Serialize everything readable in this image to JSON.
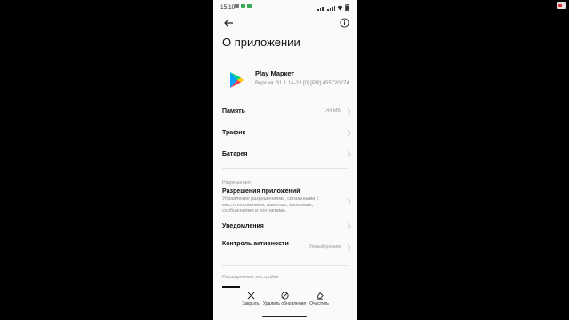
{
  "status_bar": {
    "time": "15:10",
    "right_icons": [
      "signal-icon",
      "signal-icon",
      "wifi-icon",
      "battery-icon"
    ]
  },
  "header": {
    "title": "О приложении"
  },
  "app": {
    "name": "Play Маркет",
    "version": "Версия: 31.1.14-21 [0] [PR] 455720274"
  },
  "rows": {
    "memory": {
      "label": "Память",
      "value": "144 МБ"
    },
    "traffic": {
      "label": "Трафик"
    },
    "battery": {
      "label": "Батарея"
    }
  },
  "permissions": {
    "section": "Разрешения",
    "title": "Разрешения приложений",
    "description": "Управление разрешениями, связанными с местоположением, памятью, вызовами, сообщениями и контактами."
  },
  "notifications": {
    "label": "Уведомления"
  },
  "activity": {
    "label": "Контроль активности",
    "value": "Умный режим"
  },
  "advanced": {
    "section": "Расширенные настройки"
  },
  "bottom_actions": {
    "close": "Закрыть",
    "remove_updates": "Удалить обновления",
    "clear": "Очистить"
  },
  "colors": {
    "screen_bg": "#fafafa",
    "outer_bg": "#000000",
    "text": "#111111",
    "muted": "#888888"
  }
}
